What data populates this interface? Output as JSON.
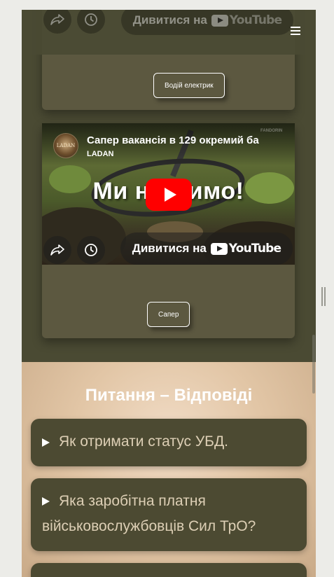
{
  "header": {
    "watch_on": "Дивитися на",
    "yt_word": "YouTube",
    "menu_icon": "hamburger-icon"
  },
  "cards": [
    {
      "button_label": "Водій електрик"
    },
    {
      "video": {
        "title": "Сапер вакансія в 129 окремий ба",
        "channel": "LADAN",
        "avatar_text": "LADAN",
        "overlay_text": "Ми н",
        "overlay_text_after": "имо!",
        "watermark": "FANDORIN",
        "watch_on": "Дивитися на",
        "yt_word": "YouTube",
        "share_icon": "share-icon",
        "watch_later_icon": "clock-icon",
        "play_icon": "play-icon"
      },
      "button_label": "Сапер"
    }
  ],
  "faq": {
    "title": "Питання – Відповіді",
    "items": [
      {
        "question": "Як отримати статус УБД."
      },
      {
        "question": "Яка заробітна платня військовослужбовців Сил ТрО?"
      },
      {
        "question": ""
      }
    ]
  },
  "colors": {
    "dark_olive": "#4a4a33",
    "card": "#5c5840",
    "faq_item": "#4c4a32",
    "youtube_red": "#ff0000"
  }
}
